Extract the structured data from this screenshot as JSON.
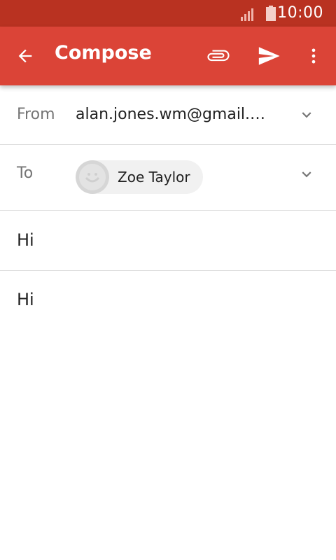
{
  "status_bar": {
    "time": "10:00"
  },
  "app_bar": {
    "title": "Compose"
  },
  "from": {
    "label": "From",
    "value": "alan.jones.wm@gmail.com"
  },
  "to": {
    "label": "To",
    "recipient": "Zoe Taylor"
  },
  "subject": {
    "value": "Hi"
  },
  "body": {
    "value": "Hi"
  },
  "colors": {
    "status_bar": "#b93221",
    "app_bar": "#db4437"
  },
  "icons": [
    "signal-icon",
    "battery-icon",
    "back-arrow-icon",
    "attachment-icon",
    "send-icon",
    "more-vert-icon",
    "chevron-down-icon",
    "avatar-icon"
  ]
}
